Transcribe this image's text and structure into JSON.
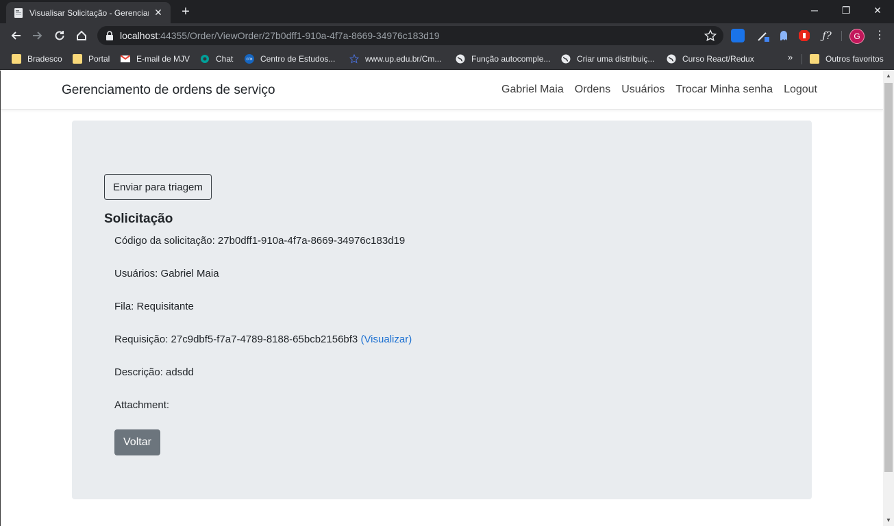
{
  "browser": {
    "tab_title": "Visualisar Solicitação - Gerenciamento de ordens de serviço",
    "url_host": "localhost",
    "url_path": ":44355/Order/ViewOrder/27b0dff1-910a-4f7a-8669-34976c183d19",
    "profile_initial": "G",
    "bookmarks": [
      {
        "label": "Bradesco",
        "icon": "folder-icon"
      },
      {
        "label": "Portal",
        "icon": "folder-icon"
      },
      {
        "label": "E-mail de MJV",
        "icon": "gmail-icon"
      },
      {
        "label": "Chat",
        "icon": "chat-icon"
      },
      {
        "label": "Centro de Estudos...",
        "icon": "otm-icon"
      },
      {
        "label": "www.up.edu.br/Cm...",
        "icon": "star-icon"
      },
      {
        "label": "Função autocomple...",
        "icon": "globe-icon"
      },
      {
        "label": "Criar uma distribuiç...",
        "icon": "globe-icon"
      },
      {
        "label": "Curso React/Redux",
        "icon": "globe-icon"
      }
    ],
    "bookmarks_more": "»",
    "other_bookmarks": "Outros favoritos"
  },
  "site": {
    "brand": "Gerenciamento de ordens de serviço",
    "nav": [
      "Gabriel Maia",
      "Ordens",
      "Usuários",
      "Trocar Minha senha",
      "Logout"
    ]
  },
  "order": {
    "send_button": "Enviar para triagem",
    "title": "Solicitação",
    "code": "Código da solicitação: 27b0dff1-910a-4f7a-8669-34976c183d19",
    "users": "Usuários: Gabriel Maia",
    "queue": "Fila: Requisitante",
    "requisition": "Requisição: 27c9dbf5-f7a7-4789-8188-65bcb2156bf3",
    "requisition_link": "(Visualizar)",
    "description": "Descrição: adsdd",
    "attachment": "Attachment:",
    "back_button": "Voltar"
  },
  "colors": {
    "jumbotron": "#e9ecef",
    "back_button": "#6c757d",
    "link": "#1a6fd1",
    "chrome_dark": "#202124",
    "chrome_toolbar": "#35363a"
  }
}
